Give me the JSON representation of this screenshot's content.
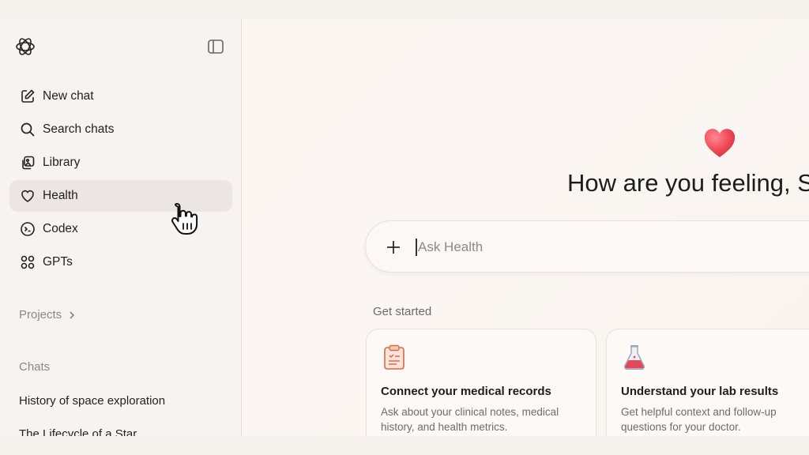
{
  "sidebar": {
    "nav": [
      {
        "label": "New chat",
        "icon": "compose-icon"
      },
      {
        "label": "Search chats",
        "icon": "search-icon"
      },
      {
        "label": "Library",
        "icon": "library-icon"
      },
      {
        "label": "Health",
        "icon": "heart-icon",
        "active": true
      },
      {
        "label": "Codex",
        "icon": "codex-icon"
      },
      {
        "label": "GPTs",
        "icon": "grid-icon"
      }
    ],
    "projects_label": "Projects",
    "chats_label": "Chats",
    "chats": [
      "History of space exploration",
      "The Lifecycle of a Star"
    ]
  },
  "main": {
    "greeting": "How are you feeling, S",
    "composer": {
      "placeholder": "Ask Health"
    },
    "get_started_label": "Get started",
    "cards": [
      {
        "icon": "clipboard-icon",
        "title": "Connect your medical records",
        "description": "Ask about your clinical notes, medical history, and health metrics."
      },
      {
        "icon": "flask-icon",
        "title": "Understand your lab results",
        "description": "Get helpful context and follow-up questions for your doctor."
      }
    ]
  },
  "colors": {
    "heart": "#f04a5a",
    "active_bg": "#ebe6e3"
  }
}
